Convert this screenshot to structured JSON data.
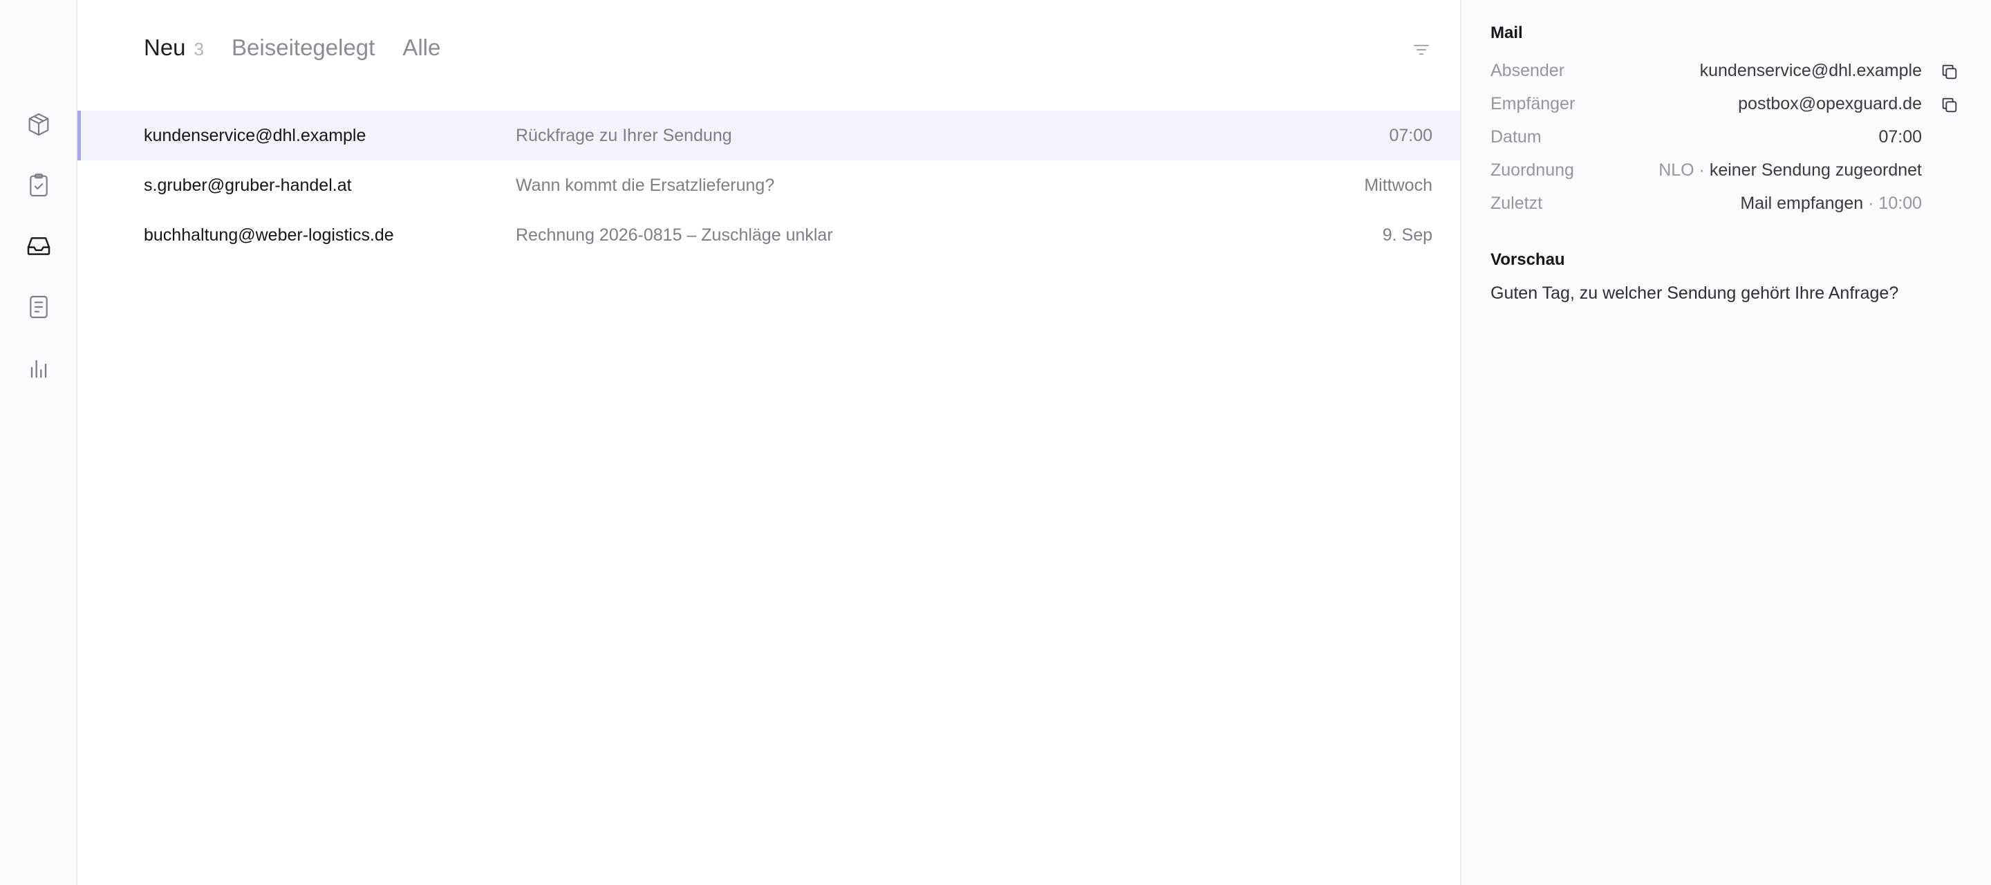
{
  "rail": {
    "items": [
      {
        "icon": "package-icon"
      },
      {
        "icon": "clipboard-check-icon"
      },
      {
        "icon": "inbox-icon",
        "active": true
      },
      {
        "icon": "document-icon"
      },
      {
        "icon": "bar-chart-icon"
      }
    ]
  },
  "tabs": {
    "new_label": "Neu",
    "new_count": "3",
    "parked_label": "Beiseitegelegt",
    "all_label": "Alle"
  },
  "mails": [
    {
      "sender": "kundenservice@dhl.example",
      "subject": "Rückfrage zu Ihrer Sendung",
      "date": "07:00"
    },
    {
      "sender": "s.gruber@gruber-handel.at",
      "subject": "Wann kommt die Ersatzlieferung?",
      "date": "Mittwoch"
    },
    {
      "sender": "buchhaltung@weber-logistics.de",
      "subject": "Rechnung 2026-0815 – Zuschläge unklar",
      "date": "9. Sep"
    }
  ],
  "detail": {
    "title": "Mail",
    "fields": {
      "sender_label": "Absender",
      "sender_value": "kundenservice@dhl.example",
      "recipient_label": "Empfänger",
      "recipient_value": "postbox@opexguard.de",
      "date_label": "Datum",
      "date_value": "07:00",
      "assignment_label": "Zuordnung",
      "assignment_prefix": "NLO · ",
      "assignment_value": "keiner Sendung zugeordnet",
      "last_label": "Zuletzt",
      "last_value": "Mail empfangen",
      "last_time": " · 10:00"
    },
    "preview_title": "Vorschau",
    "preview_text": "Guten Tag, zu welcher Sendung gehört Ihre Anfrage?"
  },
  "colors": {
    "accent": "#a9a7e4",
    "selected_row": "#f3f3fb",
    "panel_bg": "#fafbfd"
  }
}
